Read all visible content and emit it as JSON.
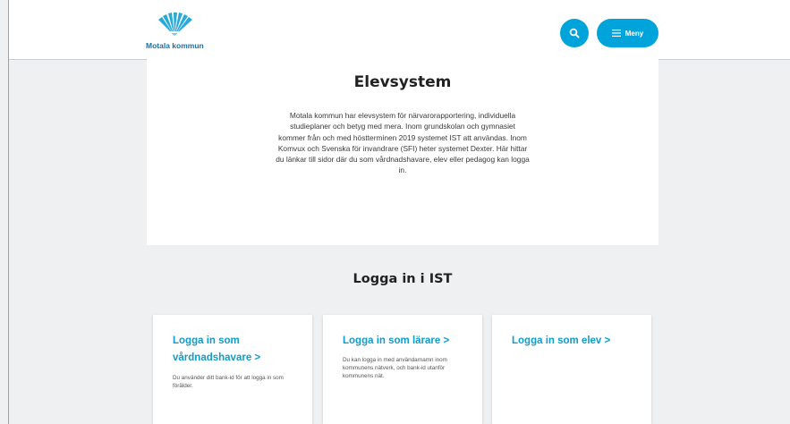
{
  "header": {
    "logo_text": "Motala kommun",
    "search_icon": "search-icon",
    "menu_label": "Meny",
    "menu_icon": "hamburger-icon"
  },
  "intro": {
    "title": "Elevsystem",
    "text": "Motala kommun har elevsystem för närvarorapportering, individuella studieplaner och betyg med mera. Inom grundskolan och gymnasiet kommer från och med höstterminen 2019 systemet IST att användas. Inom Komvux och Svenska för invandrare (SFI) heter systemet Dexter. Här hittar du länkar till sidor där du som vårdnadshavare, elev eller pedagog kan logga in."
  },
  "login": {
    "title": "Logga in i IST",
    "cards": [
      {
        "title": "Logga in som vårdnadshavare  >",
        "desc": "Du använder ditt bank-id för att logga in som förälder."
      },
      {
        "title": "Logga in som lärare  >",
        "desc": "Du kan logga in med användarnamn inom kommunens nätverk, och bank-id utanför kommunens nät."
      },
      {
        "title": "Logga in som elev  >",
        "desc": ""
      }
    ]
  },
  "colors": {
    "accent": "#00a4db",
    "link": "#0f9dcc",
    "background": "#eef0f2"
  }
}
